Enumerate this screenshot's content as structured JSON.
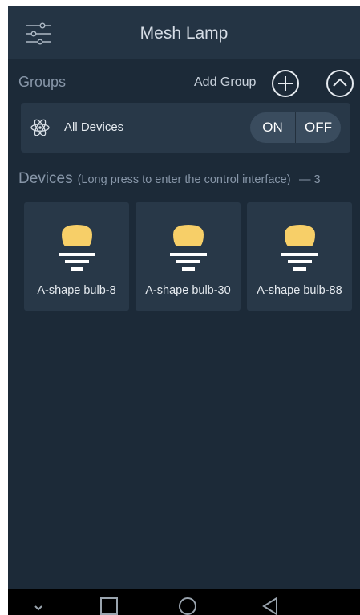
{
  "header": {
    "title": "Mesh Lamp",
    "menu_icon": "sliders-icon"
  },
  "groups": {
    "label": "Groups",
    "add_group_label": "Add Group",
    "add_icon": "plus-circle-icon",
    "collapse_icon": "chevron-up-circle-icon",
    "items": [
      {
        "name": "All Devices",
        "icon": "atom-icon",
        "on_label": "ON",
        "off_label": "OFF"
      }
    ]
  },
  "devices": {
    "label": "Devices",
    "hint": "(Long press to enter the control interface)",
    "count_text": "— 3",
    "items": [
      {
        "name": "A-shape bulb-8",
        "icon": "bulb-icon"
      },
      {
        "name": "A-shape bulb-30",
        "icon": "bulb-icon"
      },
      {
        "name": "A-shape bulb-88",
        "icon": "bulb-icon"
      }
    ]
  },
  "colors": {
    "background": "#1c2a38",
    "header": "#243444",
    "card": "#283848",
    "bulb": "#f7cf68",
    "toggle": "#3a4c5e"
  },
  "navbar": {
    "icons": [
      "chevron-down-icon",
      "square-icon",
      "circle-icon",
      "triangle-back-icon"
    ]
  }
}
